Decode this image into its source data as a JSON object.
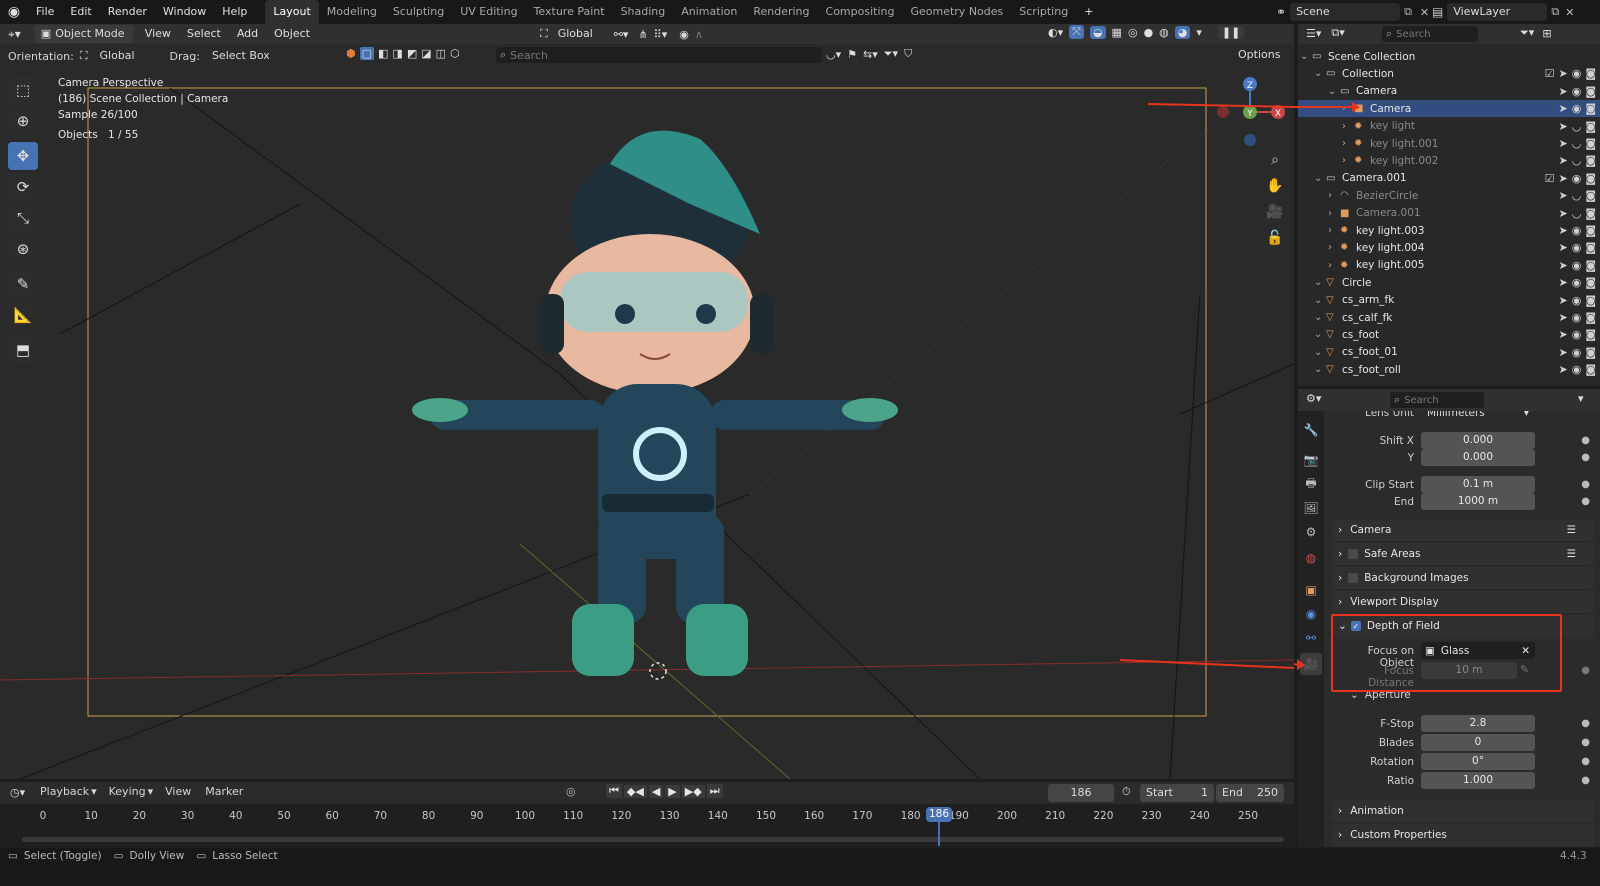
{
  "topbar": {
    "menus": [
      "File",
      "Edit",
      "Render",
      "Window",
      "Help"
    ],
    "workspaces": [
      "Layout",
      "Modeling",
      "Sculpting",
      "UV Editing",
      "Texture Paint",
      "Shading",
      "Animation",
      "Rendering",
      "Compositing",
      "Geometry Nodes",
      "Scripting"
    ],
    "active_workspace": "Layout",
    "add_tab": "+",
    "scene": "Scene",
    "view_layer": "ViewLayer"
  },
  "header": {
    "mode": "Object Mode",
    "menus": [
      "View",
      "Select",
      "Add",
      "Object"
    ],
    "transform_orientation": "Global",
    "orientation_label": "Orientation:",
    "orientation_value": "Global",
    "drag_label": "Drag:",
    "drag_value": "Select Box",
    "search_placeholder": "Search",
    "options_label": "Options"
  },
  "viewport_overlay": {
    "line1": "Camera Perspective",
    "line2": "(186) Scene Collection | Camera",
    "line3": "Sample 26/100",
    "objects_label": "Objects",
    "objects_value": "1 / 55"
  },
  "gizmo": {
    "z": "Z",
    "y": "Y",
    "x": "X"
  },
  "outliner": {
    "search_placeholder": "Search",
    "rows": [
      {
        "name": "Scene Collection",
        "indent": 0,
        "icon": "scene-collection-icon",
        "color": "#d0d0d0",
        "state": "normal"
      },
      {
        "name": "Collection",
        "indent": 1,
        "icon": "collection-icon",
        "color": "#d0d0d0",
        "state": "normal"
      },
      {
        "name": "Camera",
        "indent": 2,
        "icon": "collection-icon",
        "color": "#d0d0d0",
        "state": "normal"
      },
      {
        "name": "Camera",
        "indent": 3,
        "icon": "camera-object-icon",
        "color": "#e09a5b",
        "state": "selected"
      },
      {
        "name": "key light",
        "indent": 3,
        "icon": "light-object-icon",
        "color": "#e09a5b",
        "state": "dim"
      },
      {
        "name": "key light.001",
        "indent": 3,
        "icon": "light-object-icon",
        "color": "#e09a5b",
        "state": "dim"
      },
      {
        "name": "key light.002",
        "indent": 3,
        "icon": "light-object-icon",
        "color": "#e09a5b",
        "state": "dim"
      },
      {
        "name": "Camera.001",
        "indent": 1,
        "icon": "collection-icon",
        "color": "#d0d0d0",
        "state": "normal"
      },
      {
        "name": "BezierCircle",
        "indent": 2,
        "icon": "curve-object-icon",
        "color": "#e09a5b",
        "state": "dim"
      },
      {
        "name": "Camera.001",
        "indent": 2,
        "icon": "camera-object-icon",
        "color": "#e09a5b",
        "state": "dim"
      },
      {
        "name": "key light.003",
        "indent": 2,
        "icon": "light-object-icon",
        "color": "#e09a5b",
        "state": "normal"
      },
      {
        "name": "key light.004",
        "indent": 2,
        "icon": "light-object-icon",
        "color": "#e09a5b",
        "state": "normal"
      },
      {
        "name": "key light.005",
        "indent": 2,
        "icon": "light-object-icon",
        "color": "#e09a5b",
        "state": "normal"
      },
      {
        "name": "Circle",
        "indent": 1,
        "icon": "empty-object-icon",
        "color": "#e09a5b",
        "state": "normal"
      },
      {
        "name": "cs_arm_fk",
        "indent": 1,
        "icon": "empty-object-icon",
        "color": "#e09a5b",
        "state": "normal"
      },
      {
        "name": "cs_calf_fk",
        "indent": 1,
        "icon": "empty-object-icon",
        "color": "#e09a5b",
        "state": "normal"
      },
      {
        "name": "cs_foot",
        "indent": 1,
        "icon": "empty-object-icon",
        "color": "#e09a5b",
        "state": "normal"
      },
      {
        "name": "cs_foot_01",
        "indent": 1,
        "icon": "empty-object-icon",
        "color": "#e09a5b",
        "state": "normal"
      },
      {
        "name": "cs_foot_roll",
        "indent": 1,
        "icon": "empty-object-icon",
        "color": "#e09a5b",
        "state": "normal"
      }
    ]
  },
  "properties": {
    "search_placeholder": "Search",
    "lens_unit_label": "Lens Unit",
    "lens_unit_value": "Millimeters",
    "shift_x_label": "Shift X",
    "shift_x_value": "0.000",
    "shift_y_label": "Y",
    "shift_y_value": "0.000",
    "clip_start_label": "Clip Start",
    "clip_start_value": "0.1 m",
    "clip_end_label": "End",
    "clip_end_value": "1000 m",
    "panels": {
      "camera": "Camera",
      "safe_areas": "Safe Areas",
      "background_images": "Background Images",
      "viewport_display": "Viewport Display",
      "depth_of_field": "Depth of Field",
      "aperture": "Aperture",
      "animation": "Animation",
      "custom_properties": "Custom Properties"
    },
    "dof_enabled": true,
    "focus_object_label": "Focus on Object",
    "focus_object_value": "Glass",
    "focus_distance_label": "Focus Distance",
    "focus_distance_value": "10 m",
    "fstop_label": "F-Stop",
    "fstop_value": "2.8",
    "blades_label": "Blades",
    "blades_value": "0",
    "rotation_label": "Rotation",
    "rotation_value": "0°",
    "ratio_label": "Ratio",
    "ratio_value": "1.000"
  },
  "timeline": {
    "menus": [
      "Playback",
      "Keying",
      "View",
      "Marker"
    ],
    "current_frame": "186",
    "start_label": "Start",
    "start_value": "1",
    "end_label": "End",
    "end_value": "250",
    "ticks": [
      "0",
      "10",
      "20",
      "30",
      "40",
      "50",
      "60",
      "70",
      "80",
      "90",
      "100",
      "110",
      "120",
      "130",
      "140",
      "150",
      "160",
      "170",
      "180",
      "190",
      "200",
      "210",
      "220",
      "230",
      "240",
      "250"
    ],
    "playhead_label": "186"
  },
  "statusbar": {
    "hint1": "Select (Toggle)",
    "hint2": "Dolly View",
    "hint3": "Lasso Select",
    "version": "4.4.3"
  },
  "colors": {
    "accent": "#4772b3",
    "selection": "#334d80",
    "annotation_red": "#e8341c",
    "camera_frame": "#c9a24a"
  }
}
